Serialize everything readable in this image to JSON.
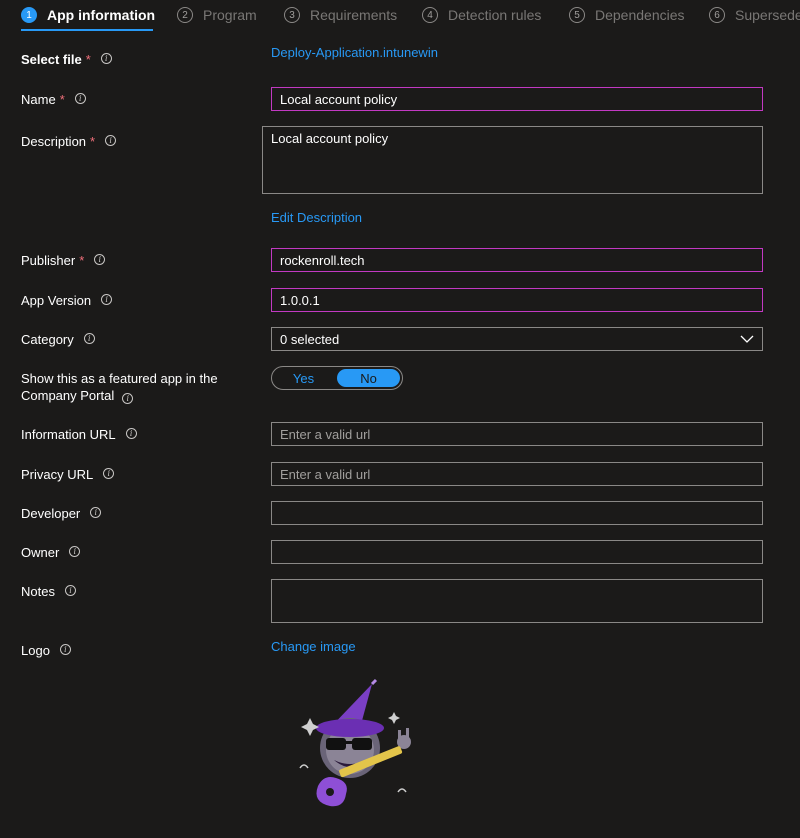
{
  "tabs": [
    {
      "num": "1",
      "label": "App information",
      "active": true
    },
    {
      "num": "2",
      "label": "Program"
    },
    {
      "num": "3",
      "label": "Requirements"
    },
    {
      "num": "4",
      "label": "Detection rules"
    },
    {
      "num": "5",
      "label": "Dependencies"
    },
    {
      "num": "6",
      "label": "Supersedence"
    }
  ],
  "form": {
    "select_file": {
      "label": "Select file",
      "value": "Deploy-Application.intunewin"
    },
    "name": {
      "label": "Name",
      "value": "Local account policy"
    },
    "description": {
      "label": "Description",
      "value": "Local account policy",
      "edit_link": "Edit Description"
    },
    "publisher": {
      "label": "Publisher",
      "value": "rockenroll.tech"
    },
    "app_version": {
      "label": "App Version",
      "value": "1.0.0.1"
    },
    "category": {
      "label": "Category",
      "value": "0 selected"
    },
    "featured": {
      "label": "Show this as a featured app in the Company Portal",
      "yes": "Yes",
      "no": "No",
      "selected": "No"
    },
    "information_url": {
      "label": "Information URL",
      "value": "",
      "placeholder": "Enter a valid url"
    },
    "privacy_url": {
      "label": "Privacy URL",
      "value": "",
      "placeholder": "Enter a valid url"
    },
    "developer": {
      "label": "Developer",
      "value": ""
    },
    "owner": {
      "label": "Owner",
      "value": ""
    },
    "notes": {
      "label": "Notes",
      "value": ""
    },
    "logo": {
      "label": "Logo",
      "change_link": "Change image"
    }
  },
  "colors": {
    "accent": "#2899f5",
    "required": "#f1707b",
    "focus_border": "#c239c2",
    "background": "#1b1a19"
  },
  "icons": {
    "info": "info-icon",
    "dropdown": "chevron-down-icon"
  }
}
